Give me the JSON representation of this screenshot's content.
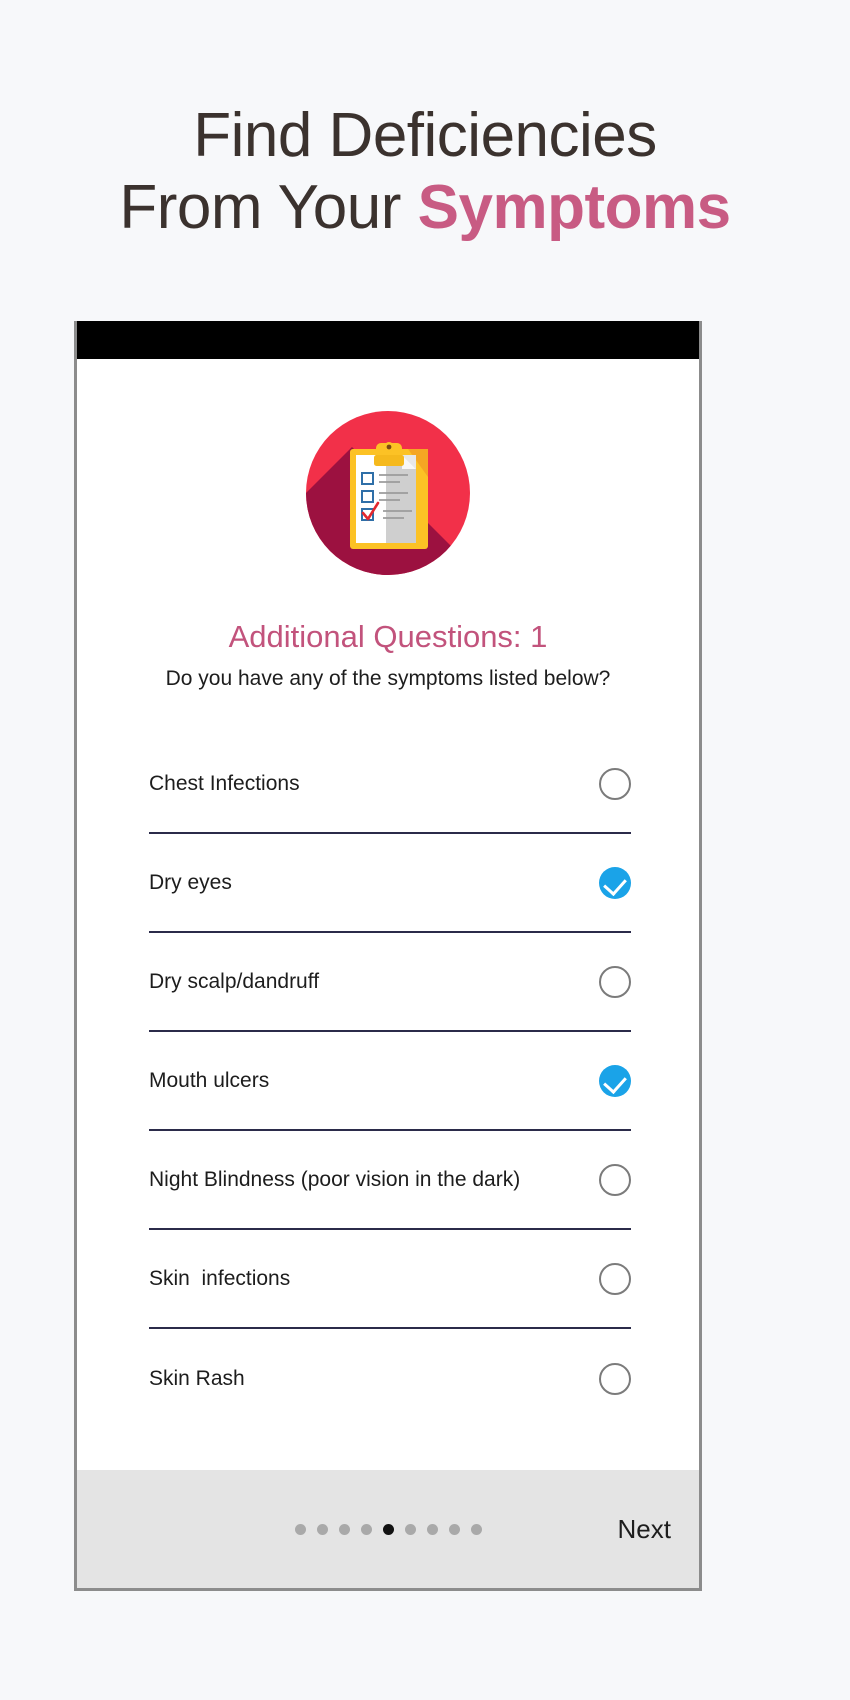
{
  "promo": {
    "line1": "Find Deficiencies",
    "line2_plain": "From Your ",
    "line2_accent": "Symptoms",
    "accent_color": "#c85b83",
    "text_color": "#3b322e"
  },
  "app": {
    "icon_name": "clipboard-checklist-icon",
    "icon_circle_color": "#f23049",
    "icon_shadow_color": "#9c1140",
    "question_title": "Additional Questions: 1",
    "question_title_color": "#c2537c",
    "question_subtitle": "Do you have any of the symptoms listed below?",
    "symptoms": [
      {
        "label": "Chest Infections",
        "checked": false
      },
      {
        "label": "Dry eyes",
        "checked": true
      },
      {
        "label": "Dry scalp/dandruff",
        "checked": false
      },
      {
        "label": "Mouth ulcers",
        "checked": true
      },
      {
        "label": "Night Blindness (poor vision in the dark)",
        "checked": false
      },
      {
        "label": "Skin  infections",
        "checked": false
      },
      {
        "label": "Skin Rash",
        "checked": false
      }
    ],
    "checked_color": "#1aa3e8",
    "unchecked_border_color": "#7b7b7b",
    "bottom": {
      "next_label": "Next",
      "dot_count": 9,
      "active_dot_index": 4,
      "active_dot_color": "#121212",
      "inactive_dot_color": "#a9a9a9",
      "bar_color": "#e4e4e4"
    }
  }
}
